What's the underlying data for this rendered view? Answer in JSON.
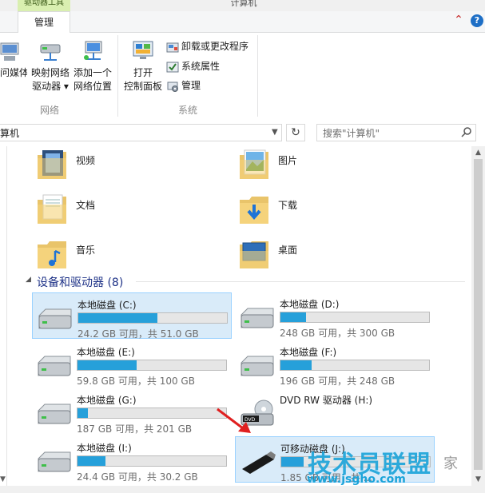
{
  "window": {
    "title": "计算机",
    "context_tab": "驱动器工具"
  },
  "ribbon": {
    "active_tab": "管理",
    "groups": [
      {
        "label": "网络",
        "buttons": [
          {
            "label": "访问媒体",
            "icon": "media-icon"
          },
          {
            "label": "映射网络\n驱动器 ▾",
            "icon": "map-network-drive-icon"
          },
          {
            "label": "添加一个\n网络位置",
            "icon": "add-network-location-icon"
          }
        ]
      },
      {
        "label": "系统",
        "open_control_panel": "打开\n控制面板",
        "small_buttons": [
          {
            "label": "卸载或更改程序",
            "icon": "uninstall-icon"
          },
          {
            "label": "系统属性",
            "icon": "system-properties-icon"
          },
          {
            "label": "管理",
            "icon": "manage-icon"
          }
        ]
      }
    ]
  },
  "address": {
    "path": "算机",
    "search_placeholder": "搜索\"计算机\""
  },
  "folders": [
    {
      "name": "视频",
      "icon": "video-folder-icon"
    },
    {
      "name": "图片",
      "icon": "pictures-folder-icon"
    },
    {
      "name": "文档",
      "icon": "documents-folder-icon"
    },
    {
      "name": "下载",
      "icon": "downloads-folder-icon"
    },
    {
      "name": "音乐",
      "icon": "music-folder-icon"
    },
    {
      "name": "桌面",
      "icon": "desktop-folder-icon"
    }
  ],
  "devices_group": {
    "title": "设备和驱动器 (8)"
  },
  "drives": [
    {
      "name": "本地磁盘 (C:)",
      "space": "24.2 GB 可用，共 51.0 GB",
      "used_fraction": 0.53,
      "selected": true
    },
    {
      "name": "本地磁盘 (D:)",
      "space": "248 GB 可用，共 300 GB",
      "used_fraction": 0.17,
      "selected": false
    },
    {
      "name": "本地磁盘 (E:)",
      "space": "59.8 GB 可用，共 100 GB",
      "used_fraction": 0.4,
      "selected": false
    },
    {
      "name": "本地磁盘 (F:)",
      "space": "196 GB 可用，共 248 GB",
      "used_fraction": 0.21,
      "selected": false
    },
    {
      "name": "本地磁盘 (G:)",
      "space": "187 GB 可用，共 201 GB",
      "used_fraction": 0.07,
      "selected": false
    },
    {
      "name": "DVD RW 驱动器 (H:)",
      "space": "",
      "used_fraction": null,
      "selected": false
    },
    {
      "name": "本地磁盘 (I:)",
      "space": "24.4 GB 可用，共 30.2 GB",
      "used_fraction": 0.19,
      "selected": false
    },
    {
      "name": "可移动磁盘 (J:)",
      "space": "1.85 GB 可用，共 ...",
      "used_fraction": 0.15,
      "selected": true
    }
  ],
  "watermark": {
    "brand": "技术员联盟",
    "url": "www.jsgho.com",
    "tail": "家"
  },
  "colors": {
    "accent": "#26a0da",
    "selection": "#d9ebf9",
    "group_header": "#1e3287",
    "context_tab": "#d9efb0"
  }
}
